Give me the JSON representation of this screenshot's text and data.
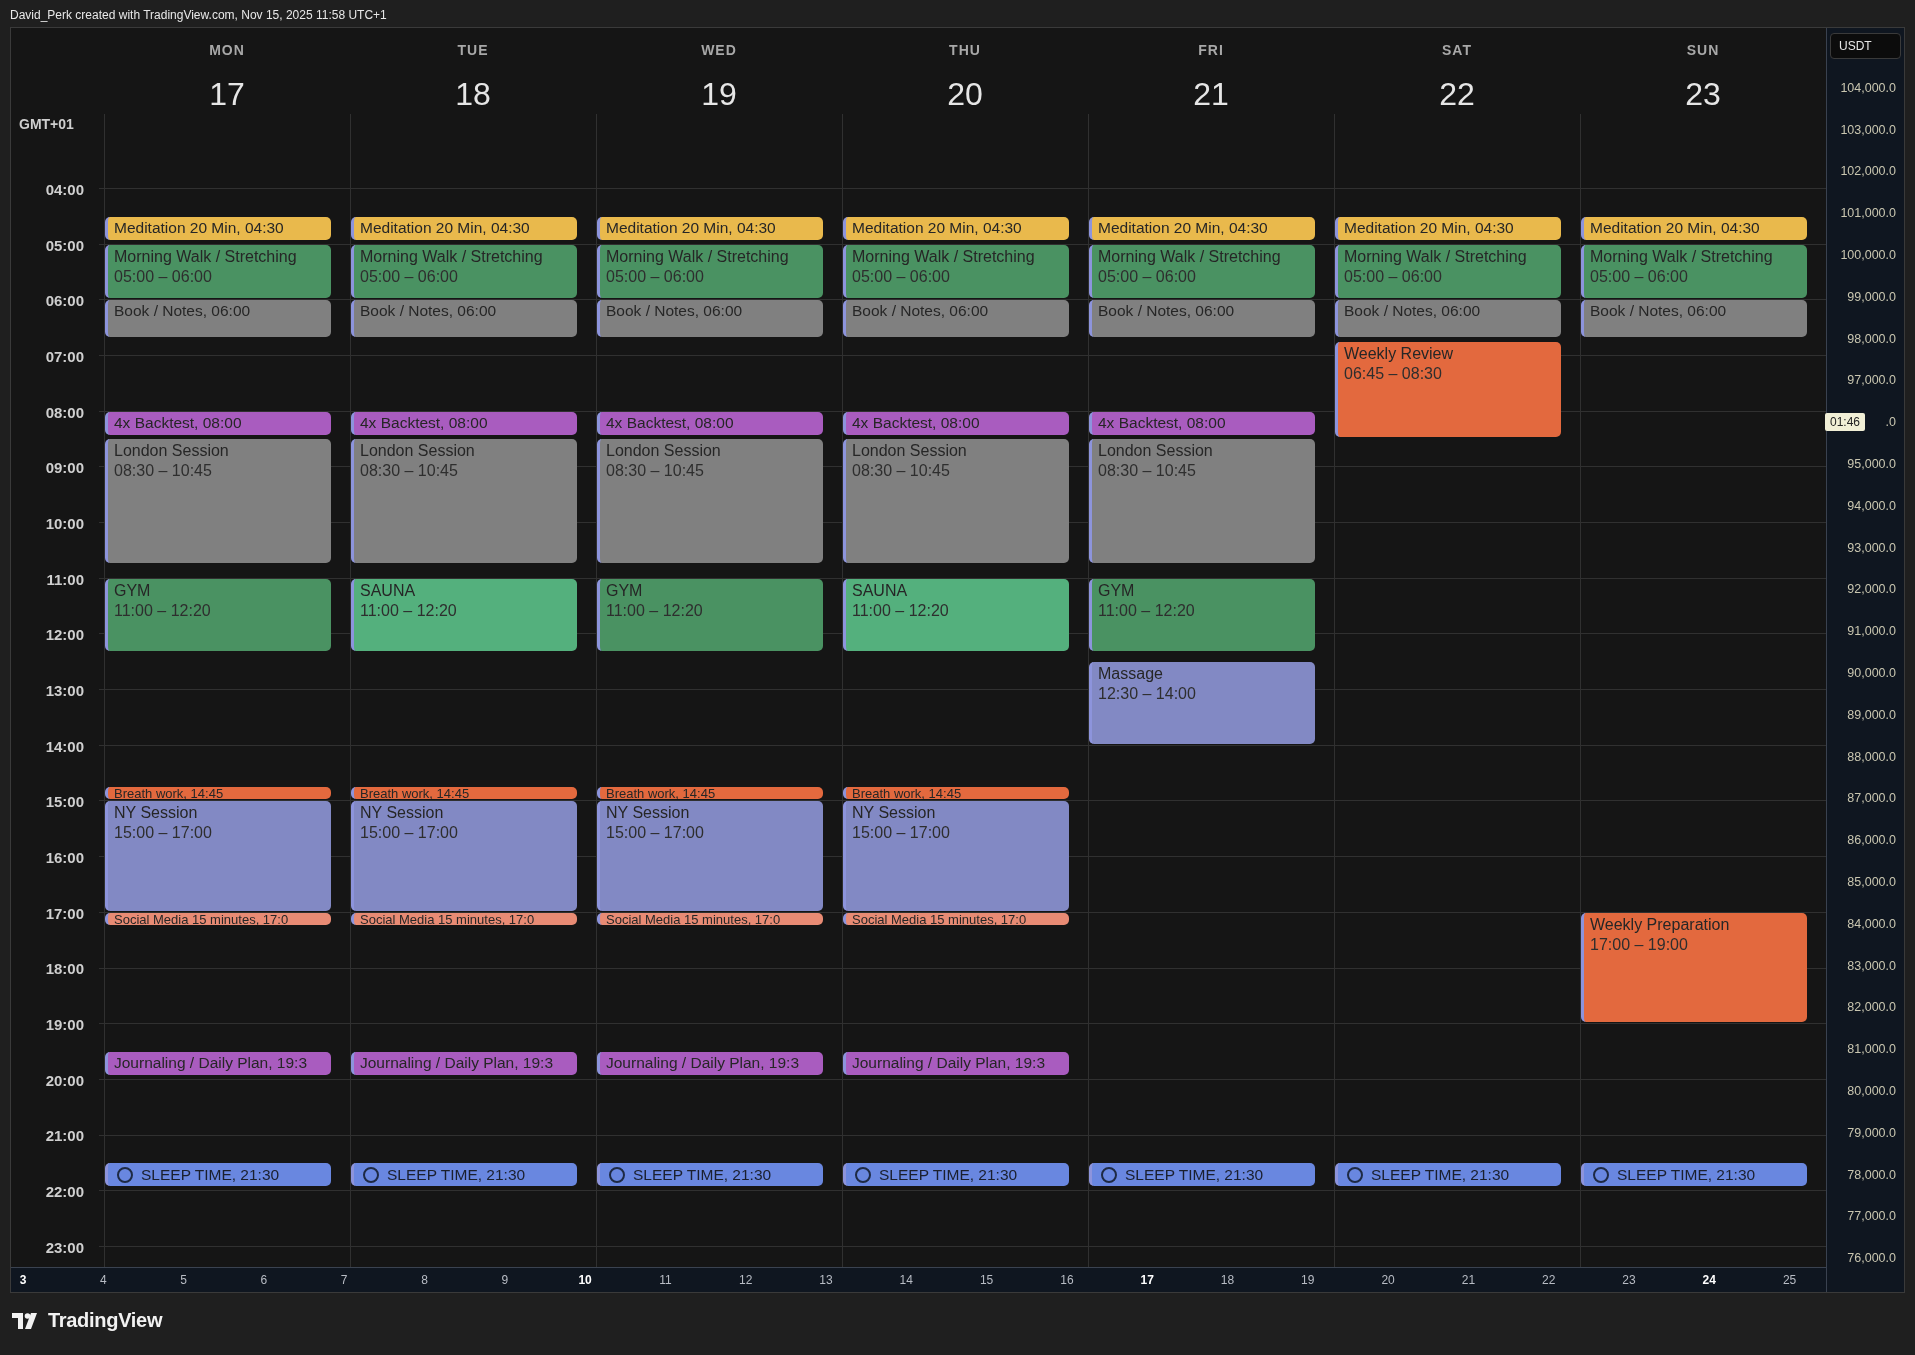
{
  "caption": "David_Perk created with TradingView.com, Nov 15, 2025 11:58 UTC+1",
  "timezone": "GMT+01",
  "hours": [
    "04:00",
    "05:00",
    "06:00",
    "07:00",
    "08:00",
    "09:00",
    "10:00",
    "11:00",
    "12:00",
    "13:00",
    "14:00",
    "15:00",
    "16:00",
    "17:00",
    "18:00",
    "19:00",
    "20:00",
    "21:00",
    "22:00",
    "23:00"
  ],
  "days": [
    {
      "name": "MON",
      "date": "17",
      "events": [
        {
          "kind": "inline",
          "label": "Meditation 20 Min, 04:30",
          "color": "#e9b94c"
        },
        {
          "kind": "block",
          "title": "Morning Walk / Stretching",
          "time": "05:00 – 06:00",
          "color": "#4a9262"
        },
        {
          "kind": "tall",
          "label": "Book / Notes, 06:00",
          "color": "#808080"
        },
        {
          "kind": "inline",
          "label": "4x Backtest, 08:00",
          "color": "#a95cbf"
        },
        {
          "kind": "block",
          "title": "London Session",
          "time": "08:30 – 10:45",
          "color": "#808080"
        },
        {
          "kind": "block",
          "title": "GYM",
          "time": "11:00 – 12:20",
          "color": "#4a9262"
        },
        {
          "kind": "thin",
          "label": "Breath work, 14:45",
          "color": "#e3693e"
        },
        {
          "kind": "block",
          "title": "NY Session",
          "time": "15:00 – 17:00",
          "color": "#8289c4"
        },
        {
          "kind": "thin",
          "label": "Social Media 15 minutes, 17:0",
          "color": "#e88b74"
        },
        {
          "kind": "inline",
          "label": "Journaling / Daily Plan, 19:3",
          "color": "#a95cbf"
        },
        {
          "kind": "task",
          "label": "SLEEP TIME, 21:30",
          "color": "#6987e0"
        }
      ]
    },
    {
      "name": "TUE",
      "date": "18",
      "events": [
        {
          "kind": "inline",
          "label": "Meditation 20 Min, 04:30",
          "color": "#e9b94c"
        },
        {
          "kind": "block",
          "title": "Morning Walk / Stretching",
          "time": "05:00 – 06:00",
          "color": "#4a9262"
        },
        {
          "kind": "tall",
          "label": "Book / Notes, 06:00",
          "color": "#808080"
        },
        {
          "kind": "inline",
          "label": "4x Backtest, 08:00",
          "color": "#a95cbf"
        },
        {
          "kind": "block",
          "title": "London Session",
          "time": "08:30 – 10:45",
          "color": "#808080"
        },
        {
          "kind": "block",
          "title": "SAUNA",
          "time": "11:00 – 12:20",
          "color": "#54b07d"
        },
        {
          "kind": "thin",
          "label": "Breath work, 14:45",
          "color": "#e3693e"
        },
        {
          "kind": "block",
          "title": "NY Session",
          "time": "15:00 – 17:00",
          "color": "#8289c4"
        },
        {
          "kind": "thin",
          "label": "Social Media 15 minutes, 17:0",
          "color": "#e88b74"
        },
        {
          "kind": "inline",
          "label": "Journaling / Daily Plan, 19:3",
          "color": "#a95cbf"
        },
        {
          "kind": "task",
          "label": "SLEEP TIME, 21:30",
          "color": "#6987e0"
        }
      ]
    },
    {
      "name": "WED",
      "date": "19",
      "events": [
        {
          "kind": "inline",
          "label": "Meditation 20 Min, 04:30",
          "color": "#e9b94c"
        },
        {
          "kind": "block",
          "title": "Morning Walk / Stretching",
          "time": "05:00 – 06:00",
          "color": "#4a9262"
        },
        {
          "kind": "tall",
          "label": "Book / Notes, 06:00",
          "color": "#808080"
        },
        {
          "kind": "inline",
          "label": "4x Backtest, 08:00",
          "color": "#a95cbf"
        },
        {
          "kind": "block",
          "title": "London Session",
          "time": "08:30 – 10:45",
          "color": "#808080"
        },
        {
          "kind": "block",
          "title": "GYM",
          "time": "11:00 – 12:20",
          "color": "#4a9262"
        },
        {
          "kind": "thin",
          "label": "Breath work, 14:45",
          "color": "#e3693e"
        },
        {
          "kind": "block",
          "title": "NY Session",
          "time": "15:00 – 17:00",
          "color": "#8289c4"
        },
        {
          "kind": "thin",
          "label": "Social Media 15 minutes, 17:0",
          "color": "#e88b74"
        },
        {
          "kind": "inline",
          "label": "Journaling / Daily Plan, 19:3",
          "color": "#a95cbf"
        },
        {
          "kind": "task",
          "label": "SLEEP TIME, 21:30",
          "color": "#6987e0"
        }
      ]
    },
    {
      "name": "THU",
      "date": "20",
      "events": [
        {
          "kind": "inline",
          "label": "Meditation 20 Min, 04:30",
          "color": "#e9b94c"
        },
        {
          "kind": "block",
          "title": "Morning Walk / Stretching",
          "time": "05:00 – 06:00",
          "color": "#4a9262"
        },
        {
          "kind": "tall",
          "label": "Book / Notes, 06:00",
          "color": "#808080"
        },
        {
          "kind": "inline",
          "label": "4x Backtest, 08:00",
          "color": "#a95cbf"
        },
        {
          "kind": "block",
          "title": "London Session",
          "time": "08:30 – 10:45",
          "color": "#808080"
        },
        {
          "kind": "block",
          "title": "SAUNA",
          "time": "11:00 – 12:20",
          "color": "#54b07d"
        },
        {
          "kind": "thin",
          "label": "Breath work, 14:45",
          "color": "#e3693e"
        },
        {
          "kind": "block",
          "title": "NY Session",
          "time": "15:00 – 17:00",
          "color": "#8289c4"
        },
        {
          "kind": "thin",
          "label": "Social Media 15 minutes, 17:0",
          "color": "#e88b74"
        },
        {
          "kind": "inline",
          "label": "Journaling / Daily Plan, 19:3",
          "color": "#a95cbf"
        },
        {
          "kind": "task",
          "label": "SLEEP TIME, 21:30",
          "color": "#6987e0"
        }
      ]
    },
    {
      "name": "FRI",
      "date": "21",
      "events": [
        {
          "kind": "inline",
          "label": "Meditation 20 Min, 04:30",
          "color": "#e9b94c"
        },
        {
          "kind": "block",
          "title": "Morning Walk / Stretching",
          "time": "05:00 – 06:00",
          "color": "#4a9262"
        },
        {
          "kind": "tall",
          "label": "Book / Notes, 06:00",
          "color": "#808080"
        },
        {
          "kind": "inline",
          "label": "4x Backtest, 08:00",
          "color": "#a95cbf"
        },
        {
          "kind": "block",
          "title": "London Session",
          "time": "08:30 – 10:45",
          "color": "#808080"
        },
        {
          "kind": "block",
          "title": "GYM",
          "time": "11:00 – 12:20",
          "color": "#4a9262"
        },
        {
          "kind": "block",
          "title": "Massage",
          "time": "12:30 – 14:00",
          "color": "#8289c4"
        },
        {
          "kind": "task",
          "label": "SLEEP TIME, 21:30",
          "color": "#6987e0"
        }
      ]
    },
    {
      "name": "SAT",
      "date": "22",
      "events": [
        {
          "kind": "inline",
          "label": "Meditation 20 Min, 04:30",
          "color": "#e9b94c"
        },
        {
          "kind": "block",
          "title": "Morning Walk / Stretching",
          "time": "05:00 – 06:00",
          "color": "#4a9262"
        },
        {
          "kind": "tall",
          "label": "Book / Notes, 06:00",
          "color": "#808080"
        },
        {
          "kind": "block",
          "title": "Weekly Review",
          "time": "06:45 – 08:30",
          "color": "#e3693e"
        },
        {
          "kind": "task",
          "label": "SLEEP TIME, 21:30",
          "color": "#6987e0"
        }
      ]
    },
    {
      "name": "SUN",
      "date": "23",
      "events": [
        {
          "kind": "inline",
          "label": "Meditation 20 Min, 04:30",
          "color": "#e9b94c"
        },
        {
          "kind": "block",
          "title": "Morning Walk / Stretching",
          "time": "05:00 – 06:00",
          "color": "#4a9262"
        },
        {
          "kind": "tall",
          "label": "Book / Notes, 06:00",
          "color": "#808080"
        },
        {
          "kind": "block",
          "title": "Weekly Preparation",
          "time": "17:00 – 19:00",
          "color": "#e3693e"
        },
        {
          "kind": "task",
          "label": "SLEEP TIME, 21:30",
          "color": "#6987e0"
        }
      ]
    }
  ],
  "price_axis": {
    "currency": "USDT",
    "labels": [
      {
        "text": "104,000.0"
      },
      {
        "text": "103,000.0"
      },
      {
        "text": "102,000.0"
      },
      {
        "text": "101,000.0"
      },
      {
        "text": "100,000.0"
      },
      {
        "text": "99,000.0"
      },
      {
        "text": "98,000.0"
      },
      {
        "text": "97,000.0"
      },
      {
        "text": ".0",
        "time_badge": "01:46"
      },
      {
        "text": "95,000.0"
      },
      {
        "text": "94,000.0"
      },
      {
        "text": "93,000.0"
      },
      {
        "text": "92,000.0"
      },
      {
        "text": "91,000.0"
      },
      {
        "text": "90,000.0"
      },
      {
        "text": "89,000.0"
      },
      {
        "text": "88,000.0"
      },
      {
        "text": "87,000.0"
      },
      {
        "text": "86,000.0"
      },
      {
        "text": "85,000.0"
      },
      {
        "text": "84,000.0"
      },
      {
        "text": "83,000.0"
      },
      {
        "text": "82,000.0"
      },
      {
        "text": "81,000.0"
      },
      {
        "text": "80,000.0"
      },
      {
        "text": "79,000.0"
      },
      {
        "text": "78,000.0"
      },
      {
        "text": "77,000.0"
      },
      {
        "text": "76,000.0"
      }
    ]
  },
  "time_axis": [
    {
      "label": "3",
      "major": true
    },
    {
      "label": "4",
      "major": false
    },
    {
      "label": "5",
      "major": false
    },
    {
      "label": "6",
      "major": false
    },
    {
      "label": "7",
      "major": false
    },
    {
      "label": "8",
      "major": false
    },
    {
      "label": "9",
      "major": false
    },
    {
      "label": "10",
      "major": true
    },
    {
      "label": "11",
      "major": false
    },
    {
      "label": "12",
      "major": false
    },
    {
      "label": "13",
      "major": false
    },
    {
      "label": "14",
      "major": false
    },
    {
      "label": "15",
      "major": false
    },
    {
      "label": "16",
      "major": false
    },
    {
      "label": "17",
      "major": true
    },
    {
      "label": "18",
      "major": false
    },
    {
      "label": "19",
      "major": false
    },
    {
      "label": "20",
      "major": false
    },
    {
      "label": "21",
      "major": false
    },
    {
      "label": "22",
      "major": false
    },
    {
      "label": "23",
      "major": false
    },
    {
      "label": "24",
      "major": true
    },
    {
      "label": "25",
      "major": false
    }
  ],
  "brand": "TradingView"
}
